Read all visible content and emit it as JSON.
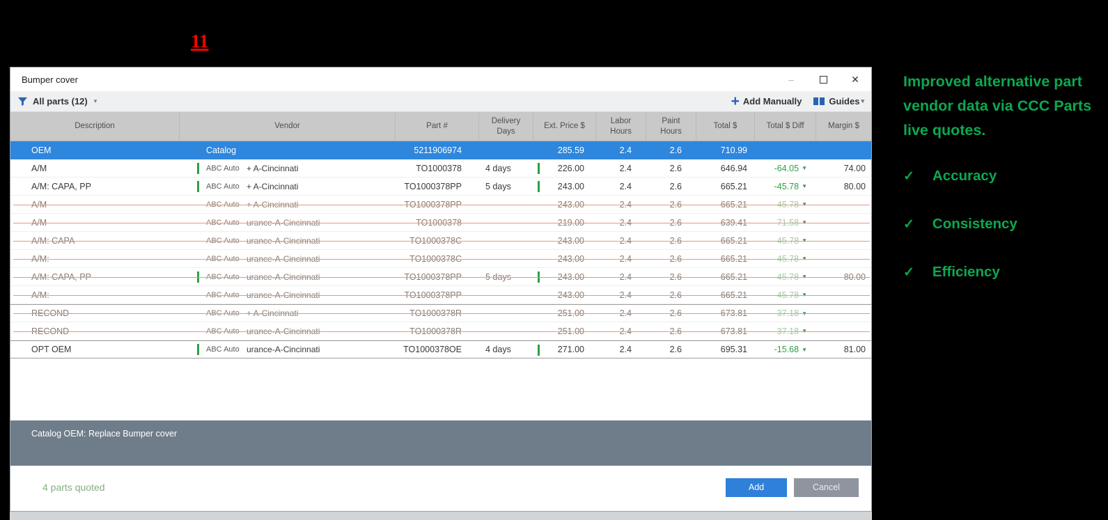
{
  "annotation": {
    "number": "11"
  },
  "icons": {
    "filter": "funnel-icon",
    "add_manually": "+",
    "guides": "open-book-icon",
    "dropdown": "▾",
    "minimize": "–",
    "maximize": "□",
    "close": "✕",
    "diff_down": "▼",
    "check": "✓"
  },
  "colors": {
    "selected_row": "#2e86dd",
    "quote_bar_green": "#2f9e44",
    "diff_green": "#2f9e44",
    "strike_salmon": "#df9c82",
    "status_slate": "#6f7d8b",
    "add_button": "#2e80d9",
    "cancel_button": "#8f959e",
    "side_green": "#0ca851",
    "annotation_red": "#ff0000"
  },
  "window": {
    "title": "Bumper cover",
    "toolbar": {
      "filter_label": "All parts (12)",
      "add_manually_label": "Add Manually",
      "guides_label": "Guides"
    },
    "table": {
      "columns": [
        "Description",
        "Vendor",
        "Part #",
        "Delivery\nDays",
        "Ext. Price $",
        "Labor\nHours",
        "Paint\nHours",
        "Total $",
        "Total $ Diff",
        "Margin $"
      ],
      "rows": [
        {
          "description": "OEM",
          "vendor_badge": "Catalog",
          "vendor_location": "",
          "part": "5211906974",
          "delivery": "",
          "ext_price": "285.59",
          "labor": "2.4",
          "paint": "2.6",
          "total": "710.99",
          "diff": "",
          "margin": "",
          "selected": true,
          "struck": false,
          "quoted": false,
          "sep_above": false
        },
        {
          "description": "A/M",
          "vendor_badge": "ABC Auto",
          "vendor_location": "+ A-Cincinnati",
          "part": "TO1000378",
          "delivery": "4 days",
          "ext_price": "226.00",
          "labor": "2.4",
          "paint": "2.6",
          "total": "646.94",
          "diff": "-64.05",
          "margin": "74.00",
          "selected": false,
          "struck": false,
          "quoted": true,
          "sep_above": false
        },
        {
          "description": "A/M: CAPA, PP",
          "vendor_badge": "ABC Auto",
          "vendor_location": "+ A-Cincinnati",
          "part": "TO1000378PP",
          "delivery": "5 days",
          "ext_price": "243.00",
          "labor": "2.4",
          "paint": "2.6",
          "total": "665.21",
          "diff": "-45.78",
          "margin": "80.00",
          "selected": false,
          "struck": false,
          "quoted": true,
          "sep_above": false
        },
        {
          "description": "A/M",
          "vendor_badge": "ABC Auto",
          "vendor_location": "+ A-Cincinnati",
          "part": "TO1000378PP",
          "delivery": "",
          "ext_price": "243.00",
          "labor": "2.4",
          "paint": "2.6",
          "total": "665.21",
          "diff": "-45.78",
          "margin": "",
          "selected": false,
          "struck": true,
          "quoted": false,
          "sep_above": false
        },
        {
          "description": "A/M",
          "vendor_badge": "ABC Auto",
          "vendor_location": "urance-A-Cincinnati",
          "part": "TO1000378",
          "delivery": "",
          "ext_price": "219.00",
          "labor": "2.4",
          "paint": "2.6",
          "total": "639.41",
          "diff": "-71.58",
          "margin": "",
          "selected": false,
          "struck": true,
          "quoted": false,
          "sep_above": false
        },
        {
          "description": "A/M: CAPA",
          "vendor_badge": "ABC Auto",
          "vendor_location": "urance-A-Cincinnati",
          "part": "TO1000378C",
          "delivery": "",
          "ext_price": "243.00",
          "labor": "2.4",
          "paint": "2.6",
          "total": "665.21",
          "diff": "-45.78",
          "margin": "",
          "selected": false,
          "struck": true,
          "quoted": false,
          "sep_above": false
        },
        {
          "description": "A/M:",
          "vendor_badge": "ABC Auto",
          "vendor_location": "urance-A-Cincinnati",
          "part": "TO1000378C",
          "delivery": "",
          "ext_price": "243.00",
          "labor": "2.4",
          "paint": "2.6",
          "total": "665.21",
          "diff": "-45.78",
          "margin": "",
          "selected": false,
          "struck": true,
          "quoted": false,
          "sep_above": false
        },
        {
          "description": "A/M: CAPA, PP",
          "vendor_badge": "ABC Auto",
          "vendor_location": "urance-A-Cincinnati",
          "part": "TO1000378PP",
          "delivery": "5 days",
          "ext_price": "243.00",
          "labor": "2.4",
          "paint": "2.6",
          "total": "665.21",
          "diff": "-45.78",
          "margin": "80.00",
          "selected": false,
          "struck": true,
          "quoted": true,
          "sep_above": false
        },
        {
          "description": "A/M:",
          "vendor_badge": "ABC Auto",
          "vendor_location": "urance-A-Cincinnati",
          "part": "TO1000378PP",
          "delivery": "",
          "ext_price": "243.00",
          "labor": "2.4",
          "paint": "2.6",
          "total": "665.21",
          "diff": "-45.78",
          "margin": "",
          "selected": false,
          "struck": true,
          "quoted": false,
          "sep_above": false
        },
        {
          "description": "RECOND",
          "vendor_badge": "ABC Auto",
          "vendor_location": "+ A-Cincinnati",
          "part": "TO1000378R",
          "delivery": "",
          "ext_price": "251.00",
          "labor": "2.4",
          "paint": "2.6",
          "total": "673.81",
          "diff": "-37.18",
          "margin": "",
          "selected": false,
          "struck": true,
          "quoted": false,
          "sep_above": true
        },
        {
          "description": "RECOND",
          "vendor_badge": "ABC Auto",
          "vendor_location": "urance-A-Cincinnati",
          "part": "TO1000378R",
          "delivery": "",
          "ext_price": "251.00",
          "labor": "2.4",
          "paint": "2.6",
          "total": "673.81",
          "diff": "-37.18",
          "margin": "",
          "selected": false,
          "struck": true,
          "quoted": false,
          "sep_above": false
        },
        {
          "description": "OPT OEM",
          "vendor_badge": "ABC Auto",
          "vendor_location": "urance-A-Cincinnati",
          "part": "TO1000378OE",
          "delivery": "4 days",
          "ext_price": "271.00",
          "labor": "2.4",
          "paint": "2.6",
          "total": "695.31",
          "diff": "-15.68",
          "margin": "81.00",
          "selected": false,
          "struck": false,
          "quoted": true,
          "sep_above": true,
          "last": true
        }
      ]
    },
    "status_bar_text": "Catalog OEM: Replace Bumper cover",
    "footer": {
      "quoted_text": "4 parts quoted",
      "add_label": "Add",
      "cancel_label": "Cancel"
    }
  },
  "side_panel": {
    "heading": "Improved alternative part vendor data via CCC Parts live quotes.",
    "items": [
      {
        "label": "Accuracy"
      },
      {
        "label": "Consistency"
      },
      {
        "label": "Efficiency"
      }
    ]
  }
}
